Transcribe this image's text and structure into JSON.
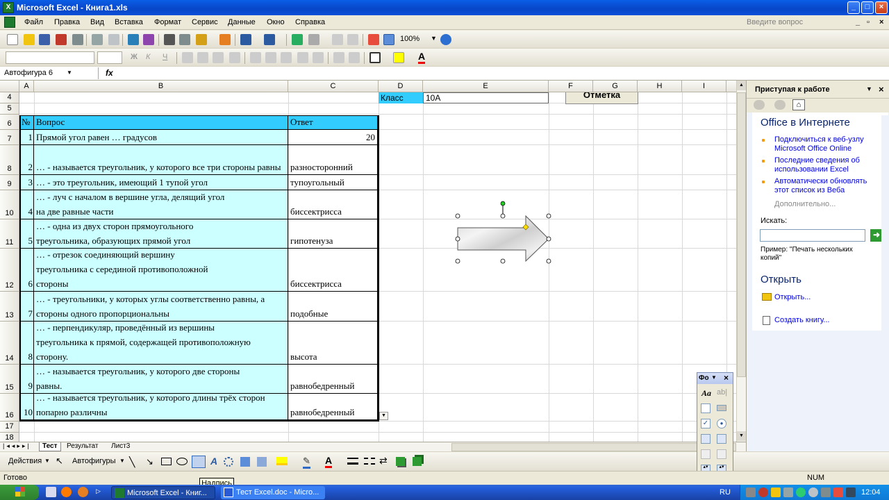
{
  "window": {
    "title": "Microsoft Excel - Книга1.xls"
  },
  "menu": [
    "Файл",
    "Правка",
    "Вид",
    "Вставка",
    "Формат",
    "Сервис",
    "Данные",
    "Окно",
    "Справка"
  ],
  "ask_placeholder": "Введите вопрос",
  "toolbar": {
    "zoom": "100%"
  },
  "namebox": "Автофигура 6",
  "fx": "fx",
  "columns": [
    "A",
    "B",
    "C",
    "D",
    "E",
    "F",
    "G",
    "H",
    "I"
  ],
  "rows": [
    "4",
    "5",
    "6",
    "7",
    "8",
    "9",
    "10",
    "11",
    "12",
    "13",
    "14",
    "15",
    "16",
    "17",
    "18"
  ],
  "top_cells": {
    "klass_label": "Класс",
    "klass_value": "10А",
    "button_label": "Отметка"
  },
  "table": {
    "header": {
      "num": "№",
      "question": "Вопрос",
      "answer": "Ответ"
    },
    "rows": [
      {
        "num": "1",
        "q": "Прямой угол равен … градусов",
        "a": "20"
      },
      {
        "num": "2",
        "q": "… - называется треугольник, у которого все три стороны равны",
        "a": "разносторонний"
      },
      {
        "num": "3",
        "q": "… - это треугольник, имеющий 1 тупой угол",
        "a": "тупоугольный"
      },
      {
        "num": "4",
        "q": "… - луч с началом в вершине угла, делящий угол на две равные части",
        "a": "биссектрисса"
      },
      {
        "num": "5",
        "q": "… - одна из двух сторон прямоугольного треугольника, образующих прямой угол",
        "a": "гипотенуза"
      },
      {
        "num": "6",
        "q": "… - отрезок соединяющий вершину треугольника с серединой противоположной стороны",
        "a": "биссектрисса"
      },
      {
        "num": "7",
        "q": "… - треугольники, у которых углы соответственно равны, а стороны одного пропорциональны",
        "a": "подобные"
      },
      {
        "num": "8",
        "q": "… - перпендикуляр, проведённый из вершины треугольника к прямой, содержащей противоположную сторону.",
        "a": "высота"
      },
      {
        "num": "9",
        "q": "… - называется треугольник, у которого две стороны равны.",
        "a": "равнобедренный"
      },
      {
        "num": "10",
        "q": "… - называется треугольник, у которого длины трёх сторон попарно различны",
        "a": "равнобедренный"
      }
    ]
  },
  "sheets": [
    "Тест",
    "Результат",
    "Лист3"
  ],
  "taskpane": {
    "title": "Приступая к работе",
    "section1": "Office в Интернете",
    "links": [
      "Подключиться к веб-узлу Microsoft Office Online",
      "Последние сведения об использовании Excel",
      "Автоматически обновлять этот список из Веба"
    ],
    "more": "Дополнительно...",
    "search_label": "Искать:",
    "example": "Пример: \"Печать нескольких копий\"",
    "section2": "Открыть",
    "open_link": "Открыть...",
    "create_link": "Создать книгу..."
  },
  "drawbar": {
    "actions": "Действия",
    "autoshapes": "Автофигуры"
  },
  "forms_title": "Фо",
  "tooltip": "Надпись",
  "status": {
    "ready": "Готово",
    "num": "NUM"
  },
  "taskbar": {
    "task1": "Microsoft Excel - Книг...",
    "task2": "Тест Excel.doc - Micro...",
    "lang": "RU",
    "clock": "12:04"
  }
}
